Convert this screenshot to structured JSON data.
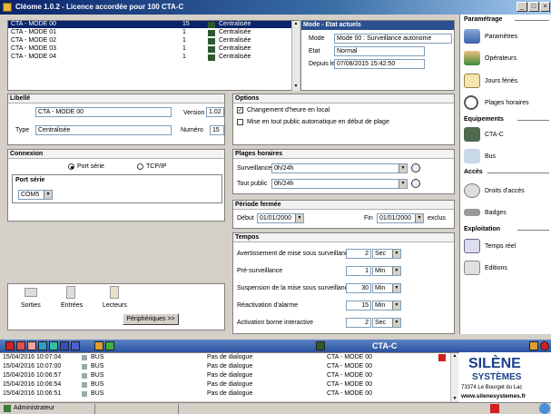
{
  "window": {
    "title": "Cléome 1.0.2 - Licence accordée pour 100 CTA-C"
  },
  "modes": [
    {
      "name": "CTA - MODE 00",
      "num": "15",
      "type": "Centralisée"
    },
    {
      "name": "CTA - MODE 01",
      "num": "1",
      "type": "Centralisée"
    },
    {
      "name": "CTA - MODE 02",
      "num": "1",
      "type": "Centralisée"
    },
    {
      "name": "CTA - MODE 03",
      "num": "1",
      "type": "Centralisée"
    },
    {
      "name": "CTA - MODE 04",
      "num": "1",
      "type": "Centralisée"
    }
  ],
  "etat": {
    "header": "Mode - Etat actuels",
    "mode_label": "Mode",
    "mode_value": "Mode 00 : Surveillance autonome",
    "etat_label": "Etat",
    "etat_value": "Normal",
    "depuis_label": "Depuis le",
    "depuis_value": "07/08/2015 15:42:50"
  },
  "libelle": {
    "header": "Libellé",
    "name_value": "CTA - MODE 00",
    "version_label": "Version",
    "version_value": "1.02",
    "type_label": "Type",
    "type_value": "Centralisée",
    "numero_label": "Numéro",
    "numero_value": "15"
  },
  "options": {
    "header": "Options",
    "opt1": "Changement d'heure en local",
    "opt2": "Mise en tout public automatique en début de plage"
  },
  "connexion": {
    "header": "Connexion",
    "port_serie": "Port série",
    "tcpip": "TCP/IP",
    "port_header": "Port série",
    "port_value": "COM5"
  },
  "plages": {
    "header": "Plages horaires",
    "surv_label": "Surveillance",
    "surv_value": "0h/24h",
    "tout_label": "Tout public",
    "tout_value": "0h/24h"
  },
  "periode": {
    "header": "Période fermée",
    "debut_label": "Début",
    "debut_value": "01/01/2000",
    "fin_label": "Fin",
    "fin_value": "01/01/2000",
    "exclus": "exclus"
  },
  "tempos": {
    "header": "Tempos",
    "rows": [
      {
        "label": "Avertissement de mise sous surveillance",
        "value": "2",
        "unit": "Sec"
      },
      {
        "label": "Pré-surveillance",
        "value": "1",
        "unit": "Min"
      },
      {
        "label": "Suspension de la mise sous surveillance",
        "value": "30",
        "unit": "Min"
      },
      {
        "label": "Réactivation d'alarme",
        "value": "15",
        "unit": "Min"
      },
      {
        "label": "Activation borne interactive",
        "value": "2",
        "unit": "Sec"
      }
    ]
  },
  "periph": {
    "sorties": "Sorties",
    "entrees": "Entrées",
    "lecteurs": "Lecteurs",
    "button": "Périphériques >>"
  },
  "sidebar": {
    "param_header": "Paramétrage",
    "parametres": "Paramètres",
    "operateurs": "Opérateurs",
    "jours": "Jours fériés",
    "plages": "Plages horaires",
    "equip_header": "Equipements",
    "ctac": "CTA-C",
    "bus": "Bus",
    "acces_header": "Accès",
    "droits": "Droits d'accès",
    "badges": "Badges",
    "exploit_header": "Exploitation",
    "temps_reel": "Temps réel",
    "editions": "Editions"
  },
  "toolbar": {
    "label": "CTA-C"
  },
  "log": [
    {
      "date": "15/04/2016 10:07:04",
      "src": "BUS",
      "msg": "Pas de dialogue",
      "mode": "CTA - MODE 00"
    },
    {
      "date": "15/04/2016 10:07:00",
      "src": "BUS",
      "msg": "Pas de dialogue",
      "mode": "CTA - MODE 00"
    },
    {
      "date": "15/04/2016 10:06:57",
      "src": "BUS",
      "msg": "Pas de dialogue",
      "mode": "CTA - MODE 00"
    },
    {
      "date": "15/04/2016 10:06:54",
      "src": "BUS",
      "msg": "Pas de dialogue",
      "mode": "CTA - MODE 00"
    },
    {
      "date": "15/04/2016 10:06:51",
      "src": "BUS",
      "msg": "Pas de dialogue",
      "mode": "CTA - MODE 00"
    }
  ],
  "logo": {
    "brand": "SILÈNE",
    "brand2": "SYSTÈMES",
    "address": "73374 Le Bourget du Lac",
    "url": "www.silenesystemes.fr"
  },
  "status": {
    "user": "Administrateur"
  }
}
